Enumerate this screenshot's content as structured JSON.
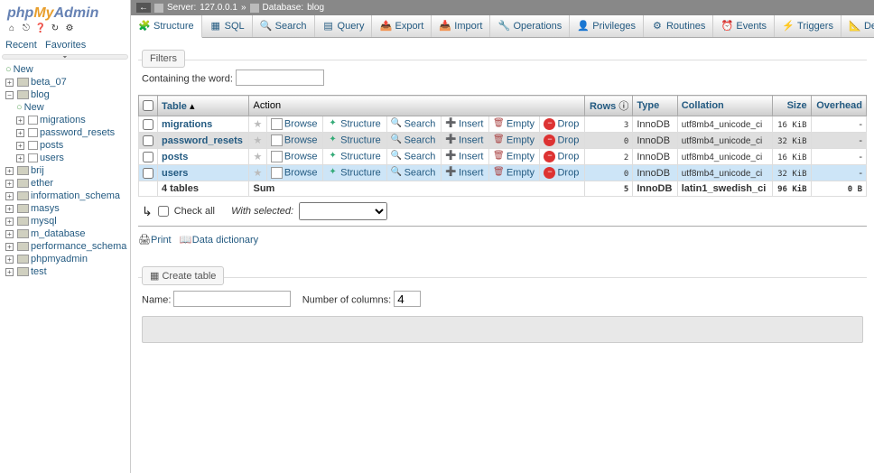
{
  "logo": {
    "part1": "php",
    "part2": "My",
    "part3": "Admin"
  },
  "sidebar_tabs": {
    "recent": "Recent",
    "favorites": "Favorites"
  },
  "tree": {
    "new": "New",
    "db_beta": "beta_07",
    "db_blog": "blog",
    "blog_new": "New",
    "blog_tables": {
      "migrations": "migrations",
      "password_resets": "password_resets",
      "posts": "posts",
      "users": "users"
    },
    "other_dbs": {
      "brij": "brij",
      "ether": "ether",
      "information_schema": "information_schema",
      "masys": "masys",
      "mysql": "mysql",
      "m_database": "m_database",
      "performance_schema": "performance_schema",
      "phpmyadmin": "phpmyadmin",
      "test": "test"
    }
  },
  "breadcrumb": {
    "server_label": "Server:",
    "server_val": "127.0.0.1",
    "sep": "»",
    "db_label": "Database:",
    "db_val": "blog"
  },
  "tabs": {
    "structure": "Structure",
    "sql": "SQL",
    "search": "Search",
    "query": "Query",
    "export": "Export",
    "import": "Import",
    "operations": "Operations",
    "privileges": "Privileges",
    "routines": "Routines",
    "events": "Events",
    "triggers": "Triggers",
    "designer": "Designer"
  },
  "filters": {
    "legend": "Filters",
    "contain_label": "Containing the word:",
    "contain_value": ""
  },
  "table_headers": {
    "table": "Table",
    "action": "Action",
    "rows": "Rows",
    "type": "Type",
    "collation": "Collation",
    "size": "Size",
    "overhead": "Overhead"
  },
  "actions": {
    "browse": "Browse",
    "structure": "Structure",
    "search": "Search",
    "insert": "Insert",
    "empty": "Empty",
    "drop": "Drop"
  },
  "rows": [
    {
      "name": "migrations",
      "rows": "3",
      "type": "InnoDB",
      "collation": "utf8mb4_unicode_ci",
      "size": "16 KiB",
      "overhead": "-",
      "highlight": false
    },
    {
      "name": "password_resets",
      "rows": "0",
      "type": "InnoDB",
      "collation": "utf8mb4_unicode_ci",
      "size": "32 KiB",
      "overhead": "-",
      "highlight": false
    },
    {
      "name": "posts",
      "rows": "2",
      "type": "InnoDB",
      "collation": "utf8mb4_unicode_ci",
      "size": "16 KiB",
      "overhead": "-",
      "highlight": false
    },
    {
      "name": "users",
      "rows": "0",
      "type": "InnoDB",
      "collation": "utf8mb4_unicode_ci",
      "size": "32 KiB",
      "overhead": "-",
      "highlight": true
    }
  ],
  "sum_row": {
    "label": "4 tables",
    "sum": "Sum",
    "rows": "5",
    "type": "InnoDB",
    "collation": "latin1_swedish_ci",
    "size": "96 KiB",
    "overhead": "0 B"
  },
  "below": {
    "check_all": "Check all",
    "with_selected": "With selected:"
  },
  "print_row": {
    "print": "Print",
    "data_dict": "Data dictionary"
  },
  "create": {
    "legend": "Create table",
    "name_label": "Name:",
    "name_value": "",
    "cols_label": "Number of columns:",
    "cols_value": "4"
  }
}
